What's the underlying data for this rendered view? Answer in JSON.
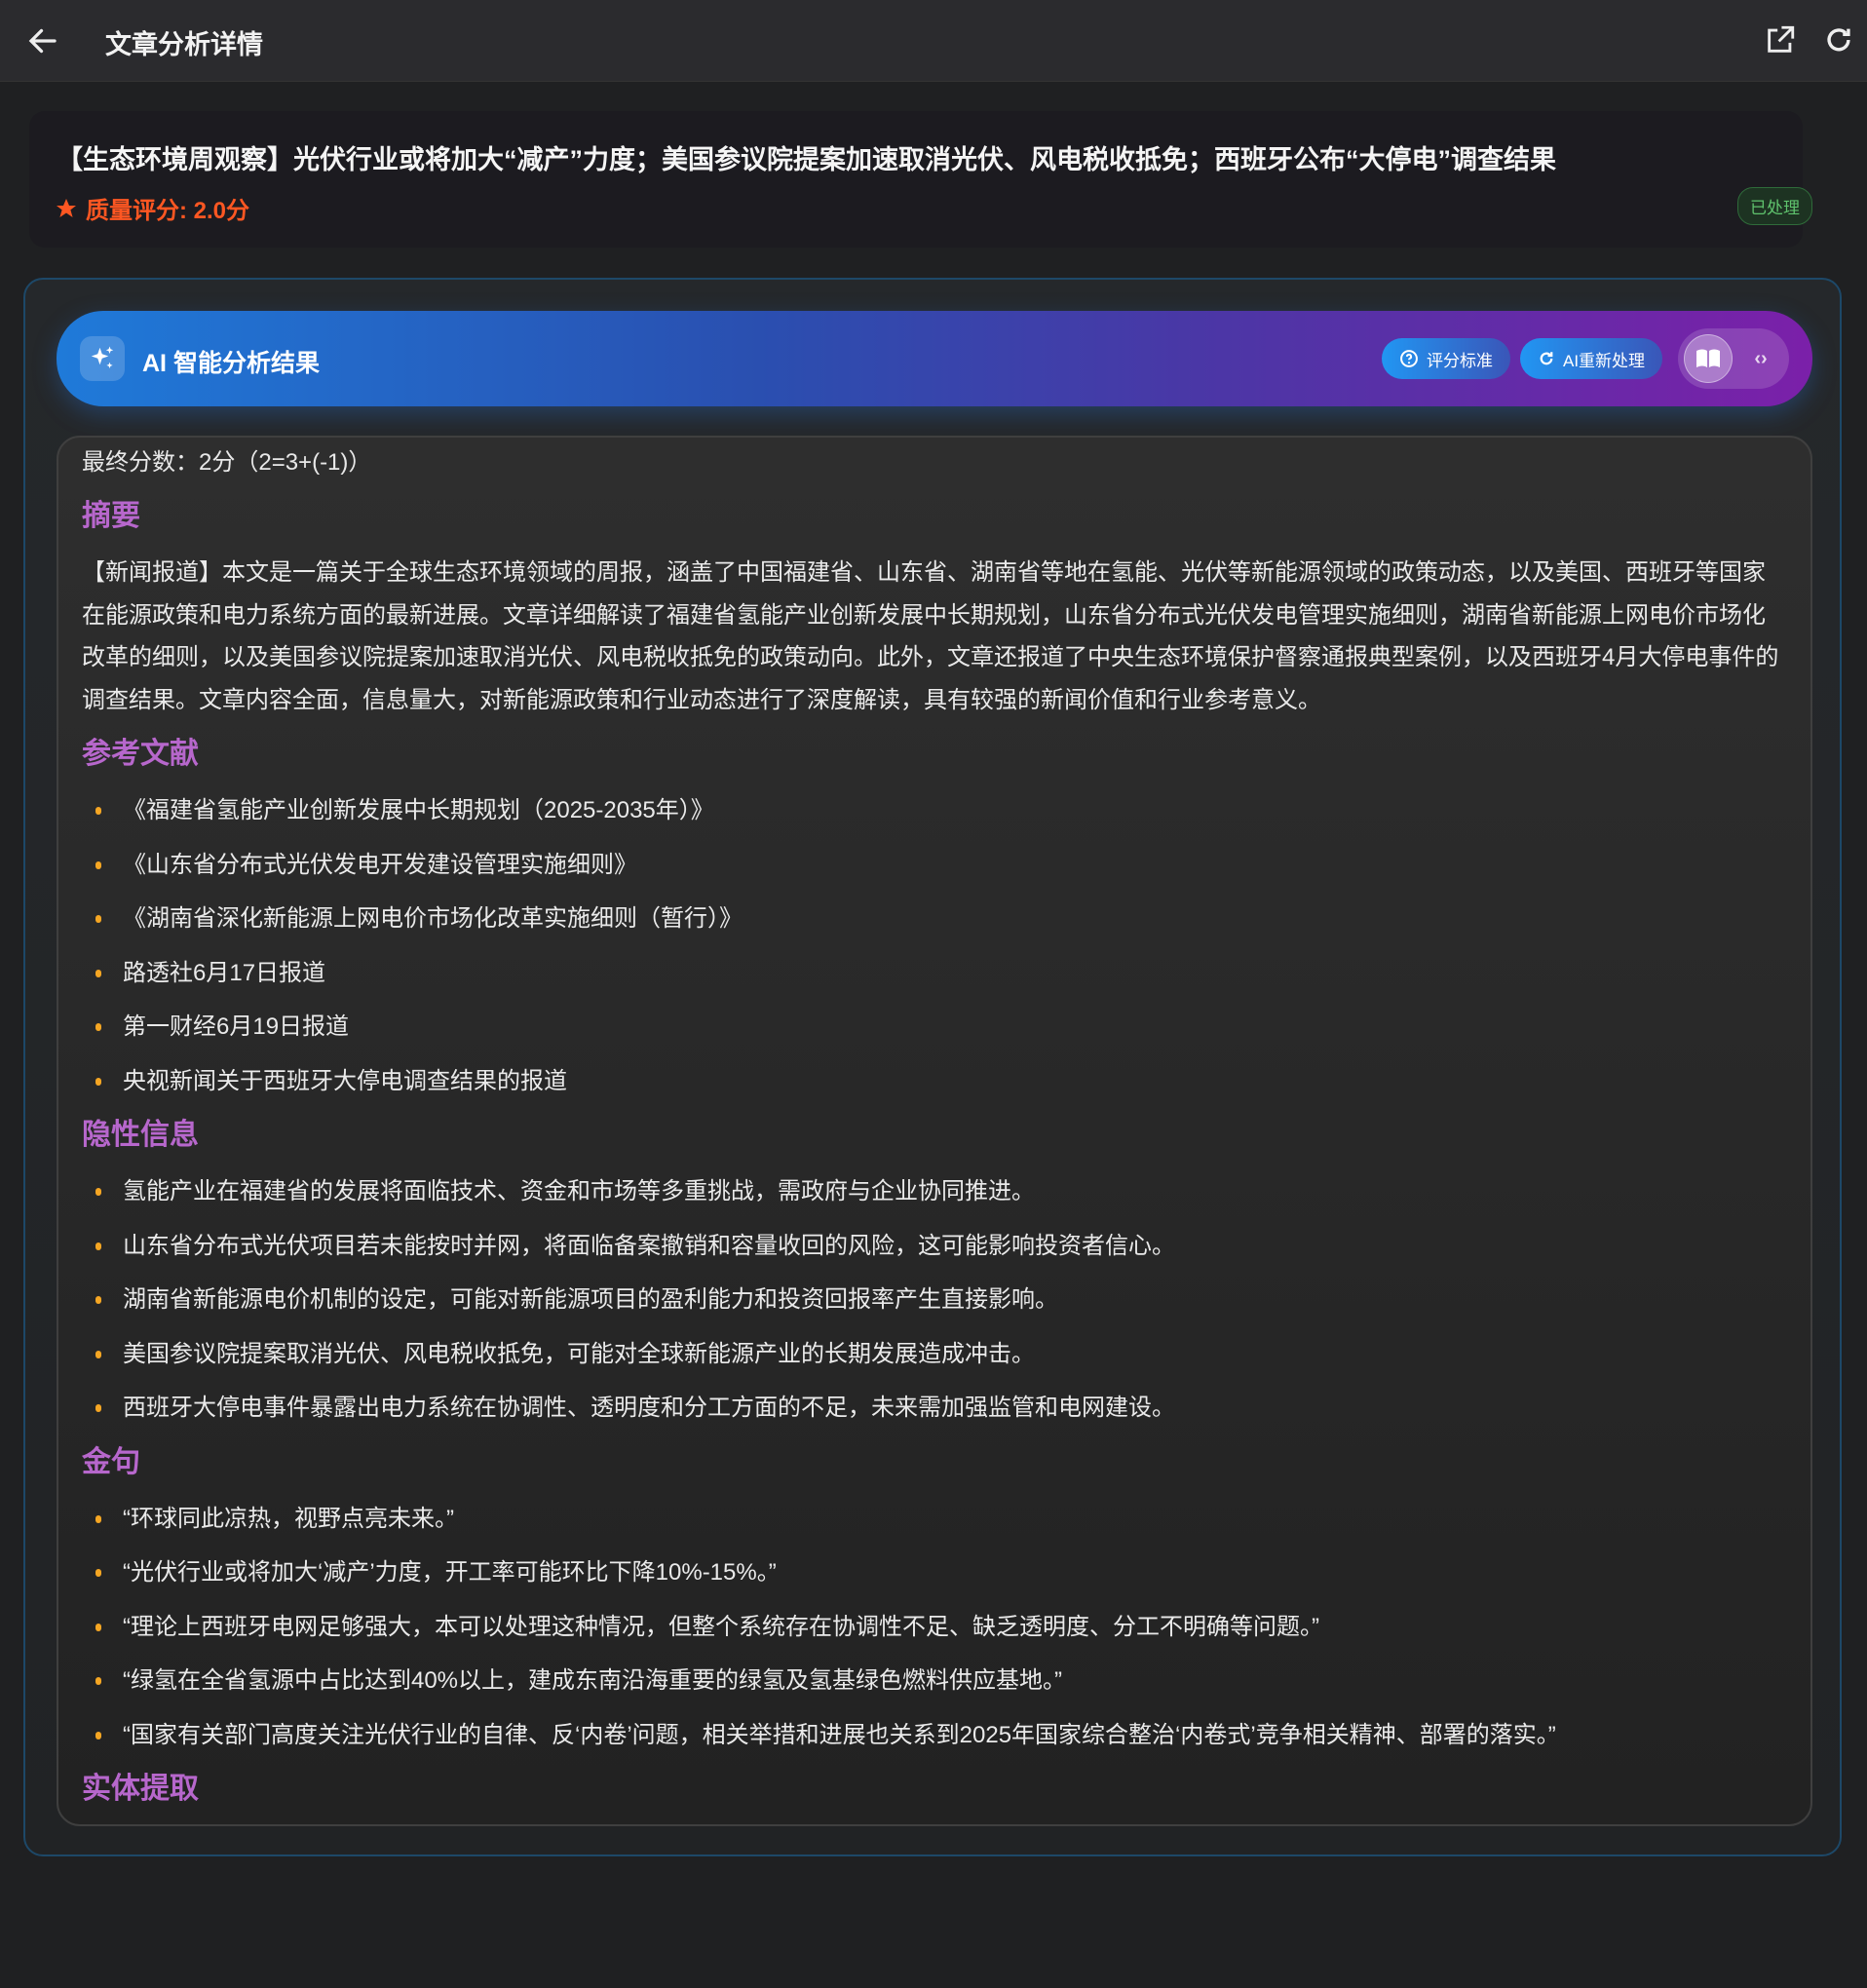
{
  "header": {
    "title": "文章分析详情",
    "back_icon": "arrow-left",
    "open_icon": "external-link",
    "refresh_icon": "refresh"
  },
  "article": {
    "title": "【生态环境周观察】光伏行业或将加大“减产”力度；美国参议院提案加速取消光伏、风电税收抵免；西班牙公布“大停电”调查结果",
    "score_label": "质量评分: 2.0分",
    "status": "已处理"
  },
  "ai": {
    "title": "AI 智能分析结果",
    "criteria_btn": "评分标准",
    "reprocess_btn": "AI重新处理",
    "view_toggle": [
      "reader",
      "code"
    ]
  },
  "analysis": {
    "final_score": "最终分数：2分（2=3+(-1)）",
    "summary_heading": "摘要",
    "summary": "【新闻报道】本文是一篇关于全球生态环境领域的周报，涵盖了中国福建省、山东省、湖南省等地在氢能、光伏等新能源领域的政策动态，以及美国、西班牙等国家在能源政策和电力系统方面的最新进展。文章详细解读了福建省氢能产业创新发展中长期规划，山东省分布式光伏发电管理实施细则，湖南省新能源上网电价市场化改革的细则，以及美国参议院提案加速取消光伏、风电税收抵免的政策动向。此外，文章还报道了中央生态环境保护督察通报典型案例，以及西班牙4月大停电事件的调查结果。文章内容全面，信息量大，对新能源政策和行业动态进行了深度解读，具有较强的新闻价值和行业参考意义。",
    "refs_heading": "参考文献",
    "refs": [
      "《福建省氢能产业创新发展中长期规划（2025-2035年）》",
      "《山东省分布式光伏发电开发建设管理实施细则》",
      "《湖南省深化新能源上网电价市场化改革实施细则（暂行）》",
      "路透社6月17日报道",
      "第一财经6月19日报道",
      "央视新闻关于西班牙大停电调查结果的报道"
    ],
    "hidden_heading": "隐性信息",
    "hidden": [
      "氢能产业在福建省的发展将面临技术、资金和市场等多重挑战，需政府与企业协同推进。",
      "山东省分布式光伏项目若未能按时并网，将面临备案撤销和容量收回的风险，这可能影响投资者信心。",
      "湖南省新能源电价机制的设定，可能对新能源项目的盈利能力和投资回报率产生直接影响。",
      "美国参议院提案取消光伏、风电税收抵免，可能对全球新能源产业的长期发展造成冲击。",
      "西班牙大停电事件暴露出电力系统在协调性、透明度和分工方面的不足，未来需加强监管和电网建设。"
    ],
    "quotes_heading": "金句",
    "quotes": [
      "“环球同此凉热，视野点亮未来。”",
      "“光伏行业或将加大‘减产’力度，开工率可能环比下降10%-15%。”",
      "“理论上西班牙电网足够强大，本可以处理这种情况，但整个系统存在协调性不足、缺乏透明度、分工不明确等问题。”",
      "“绿氢在全省氢源中占比达到40%以上，建成东南沿海重要的绿氢及氢基绿色燃料供应基地。”",
      "“国家有关部门高度关注光伏行业的自律、反‘内卷’问题，相关举措和进展也关系到2025年国家综合整治‘内卷式’竞争相关精神、部署的落实。”"
    ],
    "entities_heading": "实体提取"
  },
  "colors": {
    "accent_purple": "#b767cc",
    "score_orange": "#ff5722",
    "bullet": "#f5a623",
    "status_green": "#5fc26d"
  }
}
